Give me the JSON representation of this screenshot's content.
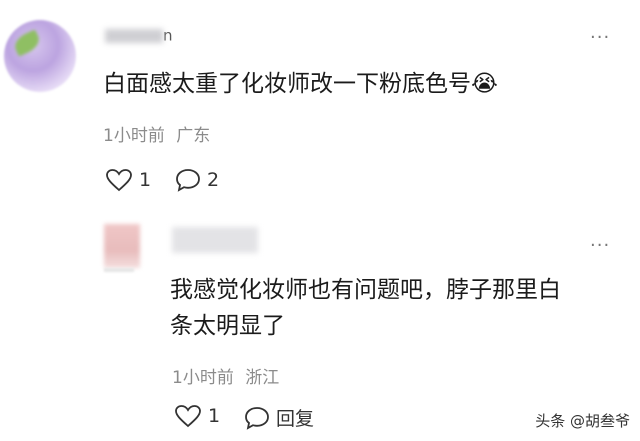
{
  "comment": {
    "author_suffix": "n",
    "text": "白面感太重了化妆师改一下粉底色号",
    "emoji": "😭",
    "time": "1小时前",
    "location": "广东",
    "likes": "1",
    "replies": "2",
    "more": "..."
  },
  "reply": {
    "text_line1": "我感觉化妆师也有问题吧，脖子那里白",
    "text_line2": "条太明显了",
    "time": "1小时前",
    "location": "浙江",
    "likes": "1",
    "reply_label": "回复",
    "more": "..."
  },
  "watermark": "头条 @胡叁爷"
}
